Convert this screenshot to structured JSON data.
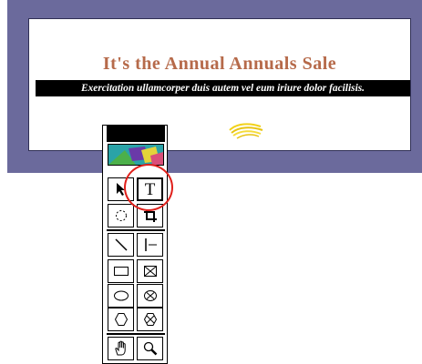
{
  "slide": {
    "title": "It's the Annual Annuals Sale",
    "subtitle": "Exercitation ullamcorper duis autem vel eum iriure dolor facilisis."
  },
  "toolbox": {
    "tools": [
      {
        "name": "pointer-tool",
        "icon": "arrow-pointer-icon"
      },
      {
        "name": "text-tool",
        "icon": "text-t-icon",
        "label": "T",
        "selected": true
      },
      {
        "name": "rotate-tool",
        "icon": "rotate-icon"
      },
      {
        "name": "crop-tool",
        "icon": "crop-icon"
      },
      {
        "name": "line-tool",
        "icon": "diagonal-line-icon"
      },
      {
        "name": "perpendicular-line-tool",
        "icon": "perpendicular-line-icon"
      },
      {
        "name": "rectangle-tool",
        "icon": "rectangle-icon"
      },
      {
        "name": "rectangle-frame-tool",
        "icon": "rectangle-x-icon"
      },
      {
        "name": "oval-tool",
        "icon": "oval-icon"
      },
      {
        "name": "oval-frame-tool",
        "icon": "oval-x-icon"
      },
      {
        "name": "polygon-tool",
        "icon": "polygon-icon"
      },
      {
        "name": "polygon-frame-tool",
        "icon": "polygon-x-icon"
      },
      {
        "name": "grabber-hand-tool",
        "icon": "hand-icon"
      },
      {
        "name": "zoom-tool",
        "icon": "magnifier-icon"
      }
    ]
  },
  "colors": {
    "frame": "#6b6a9c",
    "title": "#b66a4a",
    "highlight_circle": "#e0201b",
    "swirl": "#f2d21a"
  }
}
